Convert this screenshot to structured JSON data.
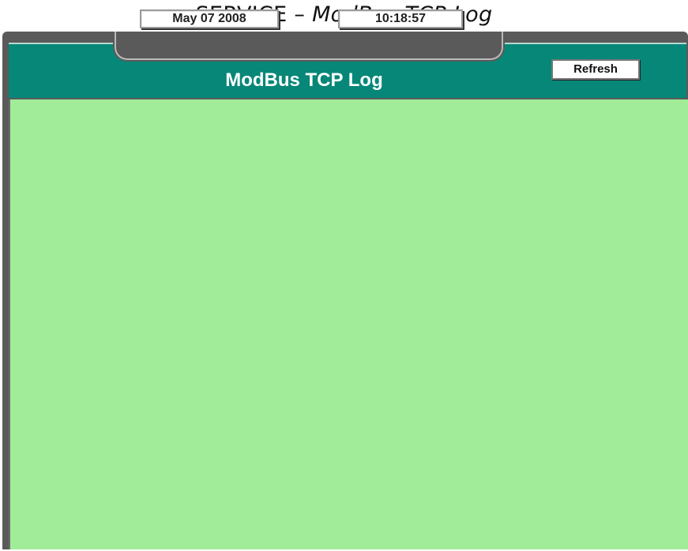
{
  "document": {
    "title_main": "SERVICE –",
    "title_sub": "ModBus TCP Log"
  },
  "header": {
    "date": "May 07 2008",
    "time": "10:18:57",
    "screen_title": "ModBus TCP Log",
    "refresh_label": "Refresh"
  },
  "log": {
    "entries": []
  },
  "colors": {
    "header_bg": "#068778",
    "log_bg": "#a1ec98",
    "frame": "#5a5a5a"
  }
}
